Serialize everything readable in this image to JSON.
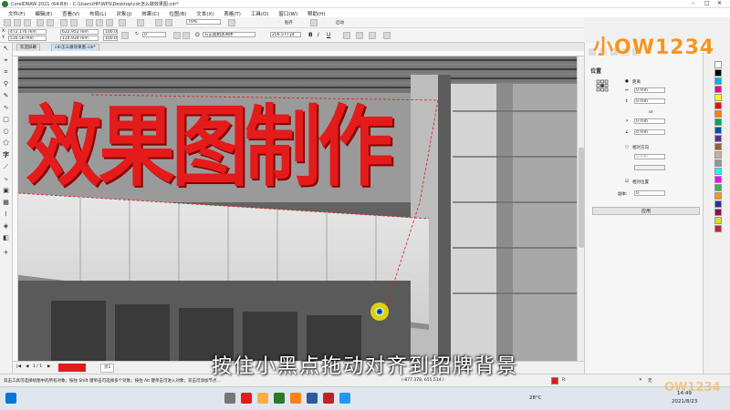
{
  "window": {
    "title": "CorelDRAW 2021 (64-Bit) - C:\\Users\\HP\\WPS\\Desktop\\cdr怎么做效果图.cdr*"
  },
  "menu": [
    "文件(F)",
    "编辑(E)",
    "查看(V)",
    "布局(L)",
    "对象(J)",
    "效果(C)",
    "位图(B)",
    "文本(X)",
    "表格(T)",
    "工具(O)",
    "窗口(W)",
    "帮助(H)"
  ],
  "toolbar": {
    "zoom": "79%",
    "snap_label": "贴齐",
    "launch_label": "启动"
  },
  "propbar": {
    "x": "472.176 mm",
    "y": "516.56 mm",
    "w": "622.952 mm",
    "h": "124.934 mm",
    "sx": "100.0",
    "sy": "100.0",
    "angle": "0",
    "font_name": "方正超粗黑简体",
    "font_size": "256.577 pt"
  },
  "tabs": {
    "welcome": "欢迎屏幕",
    "doc": "cdr怎么做效果图.cdr*"
  },
  "canvas": {
    "headline": "效果图制作"
  },
  "pagebar": {
    "page_label": "页1"
  },
  "docker": {
    "title": "位置",
    "distance_label": "距离",
    "x_value": "0 mm",
    "y_value": "0 mm",
    "or_label": "or",
    "a_value": "0 mm",
    "b_value": "0 mm",
    "relative_label": "相对方向",
    "c_value": "0 mm",
    "pos_option": "相对位置",
    "copies_label": "副本:",
    "copies_value": "0",
    "apply_label": "应用"
  },
  "status": {
    "hint": "双击工具可选择绘图中的所有对象；按住 Shift 键单击可选择多个对象；按住 Alt 键单击可进入对象；双击可添加节点…",
    "coords": "(-877.378, 655.514 )",
    "fill_label": "无"
  },
  "taskbar": {
    "temp": "28°C",
    "time": "14:49",
    "date": "2021/8/23"
  },
  "subtitle": "按住小黑点拖动对齐到招牌背景",
  "logo": "小OW1234",
  "watermark": "OW1234",
  "colors": {
    "accent": "#e31b1b",
    "palette": [
      "#ffffff",
      "#000000",
      "#ff0000",
      "#ff8000",
      "#ffff00",
      "#00a651",
      "#00aeef",
      "#0054a6",
      "#662d91",
      "#ec008c",
      "#8c6239",
      "#c7b299",
      "#959595",
      "#00ffff",
      "#ff00ff"
    ]
  }
}
